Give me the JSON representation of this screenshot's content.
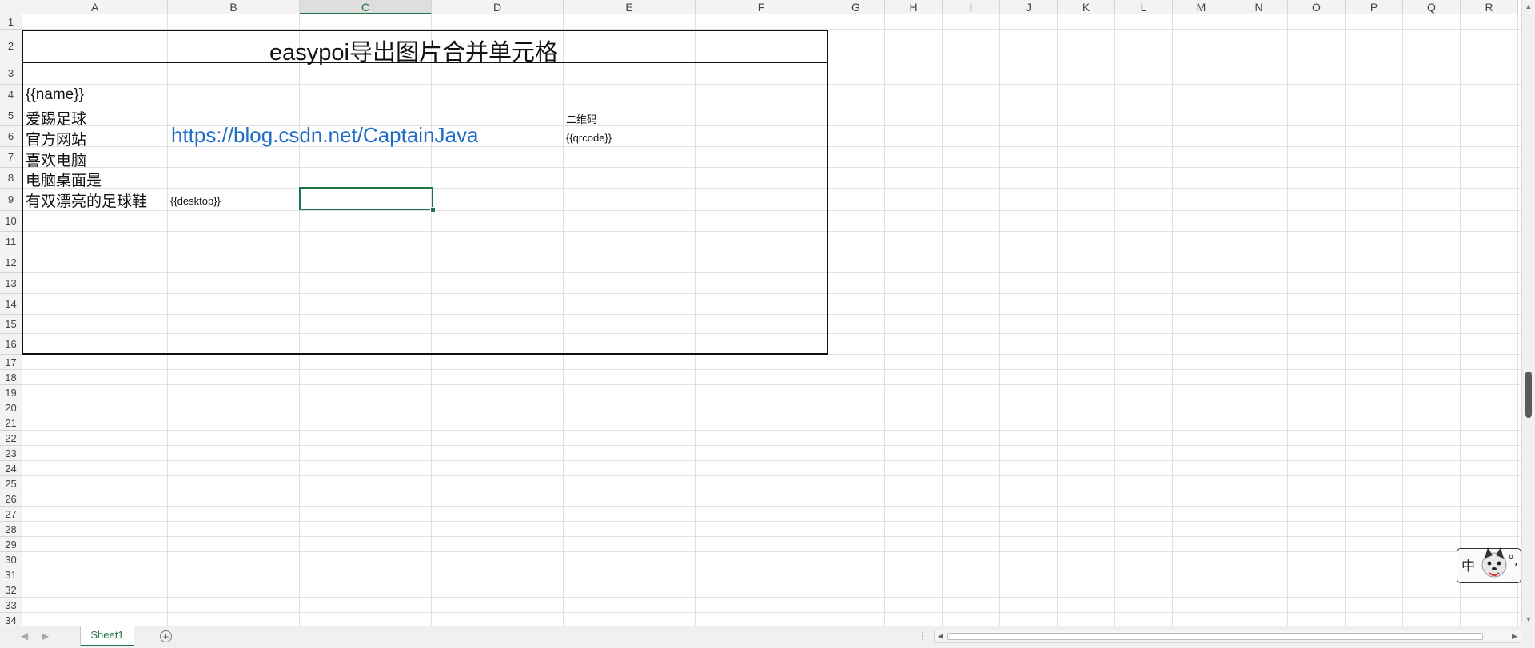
{
  "columns": [
    "A",
    "B",
    "C",
    "D",
    "E",
    "F",
    "G",
    "H",
    "I",
    "J",
    "K",
    "L",
    "M",
    "N",
    "O",
    "P",
    "Q",
    "R"
  ],
  "selected_column": "C",
  "rows": [
    "1",
    "2",
    "3",
    "4",
    "5",
    "6",
    "7",
    "8",
    "9",
    "10",
    "11",
    "12",
    "13",
    "14",
    "15",
    "16",
    "17",
    "18",
    "19",
    "20",
    "21",
    "22",
    "23",
    "24",
    "25",
    "26",
    "27",
    "28",
    "29",
    "30",
    "31",
    "32",
    "33",
    "34"
  ],
  "cells": {
    "title": "easypoi导出图片合并单元格",
    "a4": "{{name}}",
    "a5": "爱踢足球",
    "a6": "官方网站",
    "a7": "喜欢电脑",
    "a8": "电脑桌面是",
    "a9": "有双漂亮的足球鞋",
    "b6_link": "https://blog.csdn.net/CaptainJava",
    "b9": "{{desktop}}",
    "e5": "二维码",
    "e6": "{{qrcode}}"
  },
  "sheet_tabs": [
    "Sheet1"
  ],
  "active_tab": "Sheet1",
  "ime": {
    "mode": "中",
    "punct": "°,"
  },
  "colors": {
    "accent": "#217346",
    "link": "#1f6bc5"
  },
  "icons": [
    "scroll-up-arrow-icon",
    "scroll-down-arrow-icon",
    "scroll-left-arrow-icon",
    "scroll-right-arrow-icon",
    "add-sheet-icon",
    "more-dots-icon",
    "sheet-nav-prev-icon",
    "sheet-nav-next-icon",
    "ime-mascot-icon"
  ]
}
